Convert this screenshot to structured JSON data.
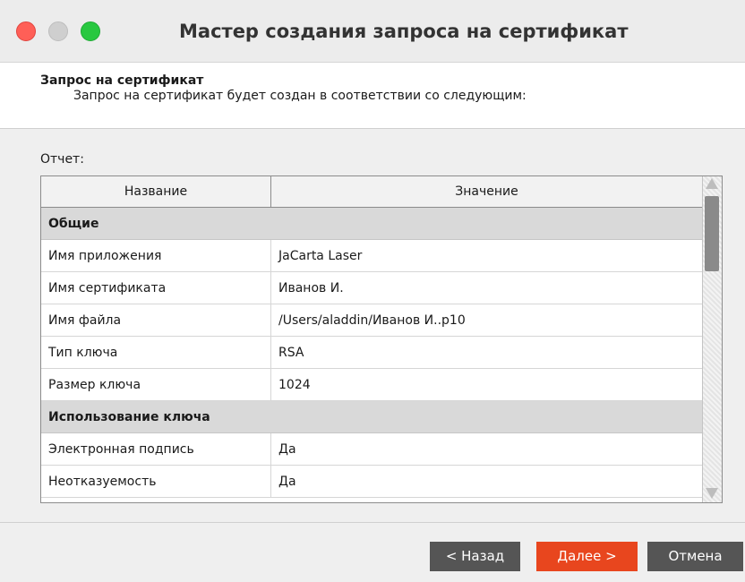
{
  "window": {
    "title": "Мастер создания запроса на сертификат"
  },
  "header": {
    "title": "Запрос на сертификат",
    "subtitle": "Запрос на сертификат будет создан в соответствии со следующим:"
  },
  "report": {
    "label": "Отчет:",
    "columns": [
      "Название",
      "Значение"
    ],
    "sections": [
      {
        "name": "Общие",
        "rows": [
          {
            "name": "Имя приложения",
            "value": "JaCarta Laser"
          },
          {
            "name": "Имя сертификата",
            "value": "Иванов И."
          },
          {
            "name": "Имя файла",
            "value": "/Users/aladdin/Иванов И..p10"
          },
          {
            "name": "Тип ключа",
            "value": "RSA"
          },
          {
            "name": "Размер ключа",
            "value": "1024"
          }
        ]
      },
      {
        "name": "Использование ключа",
        "rows": [
          {
            "name": "Электронная подпись",
            "value": "Да"
          },
          {
            "name": "Неотказуемость",
            "value": "Да"
          }
        ]
      }
    ]
  },
  "buttons": {
    "back": "< Назад",
    "next": "Далее >",
    "cancel": "Отмена"
  },
  "colors": {
    "accent": "#e8461e",
    "button_dark": "#555555",
    "group_bg": "#d9d9d9"
  }
}
